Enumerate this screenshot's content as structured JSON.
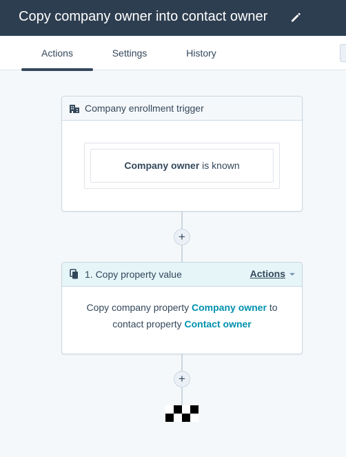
{
  "header": {
    "title": "Copy company owner into contact owner",
    "edit_icon": "pencil-icon"
  },
  "tabs": [
    {
      "label": "Actions",
      "active": true
    },
    {
      "label": "Settings",
      "active": false
    },
    {
      "label": "History",
      "active": false
    }
  ],
  "trigger": {
    "icon": "building-icon",
    "title": "Company enrollment trigger",
    "condition": {
      "property": "Company owner",
      "operator": "is known"
    }
  },
  "action": {
    "icon": "copy-icon",
    "title": "1. Copy property value",
    "menu_label": "Actions",
    "line1_prefix": "Copy company property",
    "source_property": "Company owner",
    "line1_suffix": "to",
    "line2_prefix": "contact property",
    "target_property": "Contact owner"
  },
  "add_button": {
    "symbol": "+"
  },
  "end_icon": "checkered-flag-icon",
  "colors": {
    "header_bg": "#2d3e50",
    "link": "#0091ae",
    "action_header_bg": "#e5f5f8",
    "page_bg": "#f5f8fa"
  }
}
